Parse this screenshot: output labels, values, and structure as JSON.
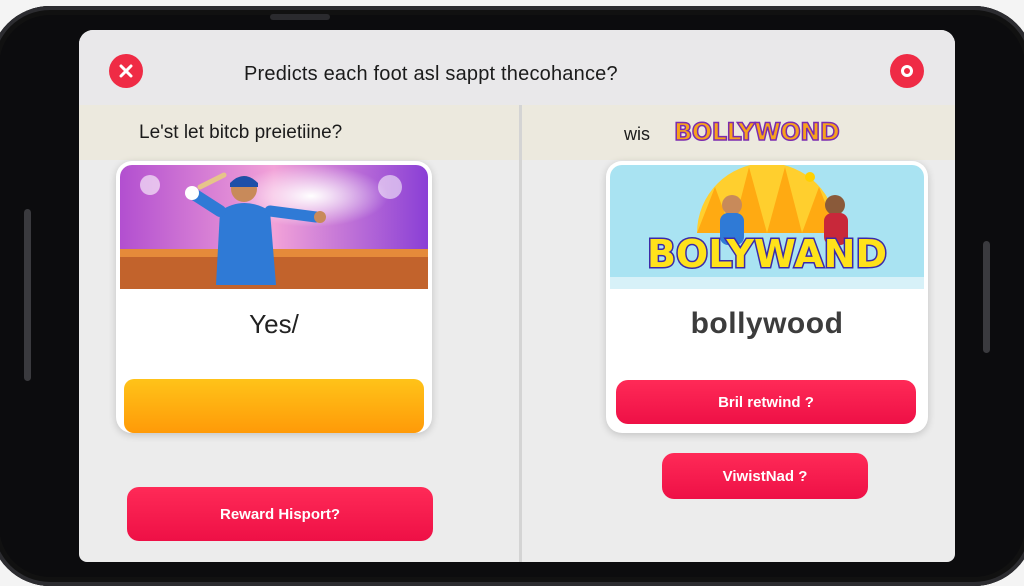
{
  "header": {
    "title": "Predicts each foot asl sappt thecohance?"
  },
  "left_panel": {
    "subtitle": "Le'st let bitcb preietiine?",
    "card_label": "Yes/",
    "reward_button": "Reward Hisport?"
  },
  "right_panel": {
    "prefix": "wis",
    "logo_text": "BOLLYWOND",
    "banner_text": "BOLYWAND",
    "card_label": "bollywood",
    "primary_button": "Bril retwind ?",
    "secondary_button": "ViwistNad ?"
  },
  "colors": {
    "accent_red": "#ef2b45",
    "orange_bar": "#ff9a08",
    "logo_yellow": "#f7a21b",
    "logo_purple": "#7b2bb0"
  },
  "icons": [
    "close-icon",
    "circle-icon"
  ]
}
